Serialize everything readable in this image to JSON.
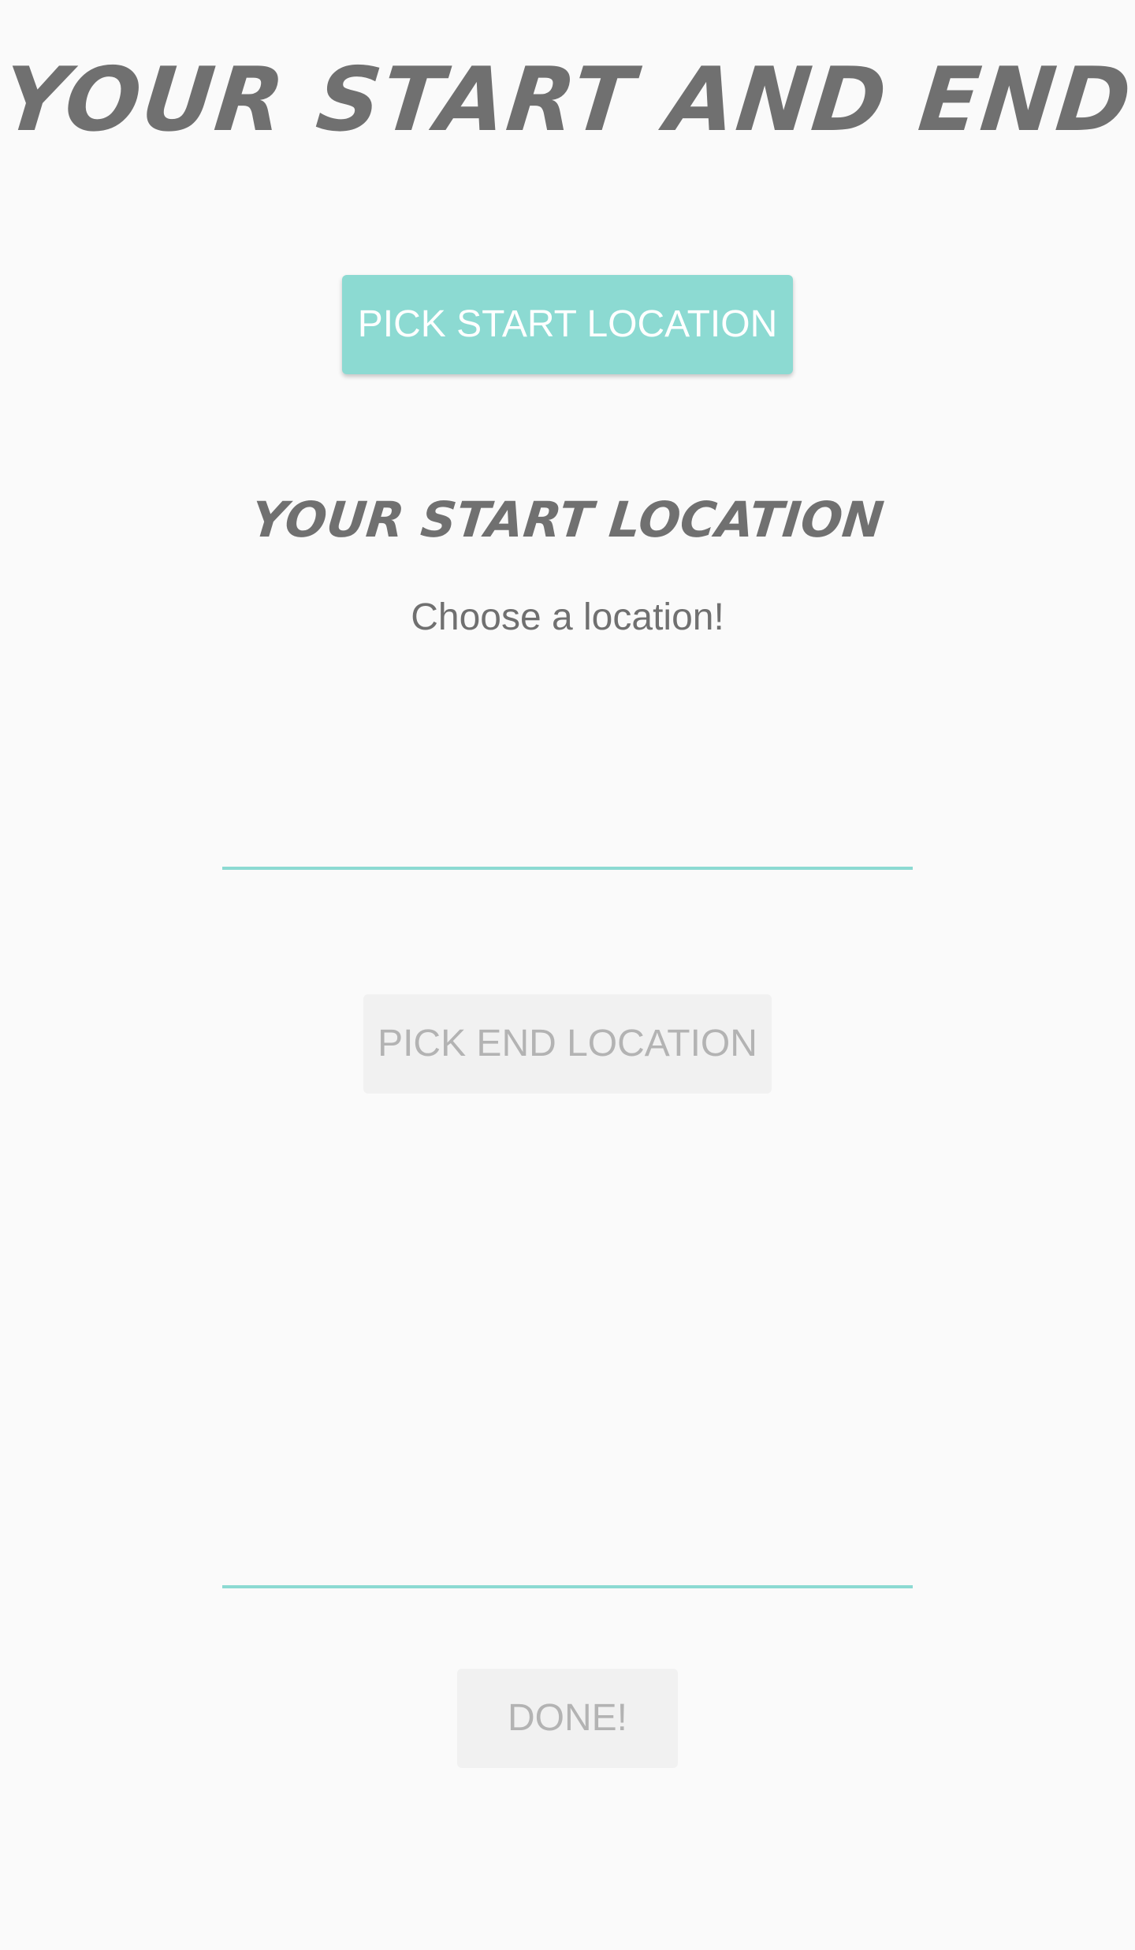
{
  "header": {
    "title": "YOUR START AND END"
  },
  "start": {
    "button_label": "PICK START LOCATION",
    "section_title": "YOUR START LOCATION",
    "status": "Choose a location!",
    "field_value": ""
  },
  "end": {
    "button_label": "PICK END LOCATION",
    "field_value": ""
  },
  "footer": {
    "done_label": "DONE!"
  },
  "colors": {
    "accent": "#8cdad2",
    "text": "#707070",
    "disabled_bg": "#f1f1f1",
    "disabled_text": "#b3b3b3",
    "background": "#fafafa"
  }
}
